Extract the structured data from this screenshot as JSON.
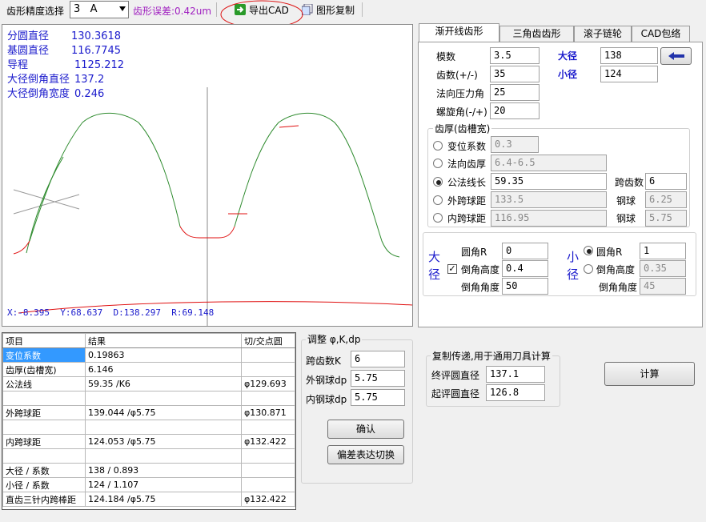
{
  "toolbar": {
    "precision_label": "齿形精度选择",
    "precision_value": "3   A",
    "error_text": "齿形误差:0.42um",
    "export_cad": "导出CAD",
    "copy_graph": "图形复制"
  },
  "overlay": {
    "lines": [
      {
        "label": "分圆直径",
        "value": "130.3618"
      },
      {
        "label": "基圆直径",
        "value": "116.7745"
      },
      {
        "label": "导程",
        "value": "1125.212"
      },
      {
        "label": "大径倒角直径",
        "value": "137.2"
      },
      {
        "label": "大径倒角宽度",
        "value": "0.246"
      }
    ],
    "coords": "X:-8.395  Y:68.637  D:138.297  R:69.148"
  },
  "tabs": [
    {
      "label": "渐开线齿形",
      "active": true
    },
    {
      "label": "三角齿齿形",
      "active": false
    },
    {
      "label": "滚子链轮",
      "active": false
    },
    {
      "label": "CAD包络",
      "active": false
    }
  ],
  "params": {
    "module_label": "模数",
    "module_value": "3.5",
    "teeth_label": "齿数(+/-)",
    "teeth_value": "35",
    "pressure_label": "法向压力角",
    "pressure_value": "25",
    "helix_label": "螺旋角(-/+)",
    "helix_value": "20",
    "major_label": "大径",
    "major_value": "138",
    "minor_label": "小径",
    "minor_value": "124"
  },
  "thickness": {
    "group_label": "齿厚(齿槽宽)",
    "options": [
      {
        "label": "变位系数",
        "value": "0.3",
        "selected": false
      },
      {
        "label": "法向齿厚",
        "value": "6.4-6.5",
        "selected": false
      },
      {
        "label": "公法线长",
        "value": "59.35",
        "selected": true
      },
      {
        "label": "外跨球距",
        "value": "133.5",
        "selected": false
      },
      {
        "label": "内跨球距",
        "value": "116.95",
        "selected": false
      }
    ],
    "span_label": "跨齿数",
    "span_value": "6",
    "ball1_label": "钢球",
    "ball1_value": "6.25",
    "ball2_label": "钢球",
    "ball2_value": "5.75"
  },
  "major_end": {
    "side_label": "大径",
    "fillet_label": "圆角R",
    "fillet_value": "0",
    "chamfer_h_label": "倒角高度",
    "chamfer_h_value": "0.4",
    "chamfer_a_label": "倒角角度",
    "chamfer_a_value": "50"
  },
  "minor_end": {
    "side_label": "小径",
    "fillet_label": "圆角R",
    "fillet_value": "1",
    "chamfer_h_label": "倒角高度",
    "chamfer_h_value": "0.35",
    "chamfer_a_label": "倒角角度",
    "chamfer_a_value": "45"
  },
  "results": {
    "headers": [
      "项目",
      "结果",
      "切/交点圆"
    ],
    "rows": [
      [
        "变位系数",
        "0.19863",
        ""
      ],
      [
        "齿厚(齿槽宽)",
        "6.146",
        ""
      ],
      [
        "公法线",
        "59.35 /K6",
        "φ129.693"
      ],
      [
        "",
        "",
        ""
      ],
      [
        "外跨球距",
        "139.044 /φ5.75",
        "φ130.871"
      ],
      [
        "",
        "",
        ""
      ],
      [
        "内跨球距",
        "124.053 /φ5.75",
        "φ132.422"
      ],
      [
        "",
        "",
        ""
      ],
      [
        "大径 / 系数",
        "138 / 0.893",
        ""
      ],
      [
        "小径 / 系数",
        "124 / 1.107",
        ""
      ],
      [
        "直齿三针内跨棒距",
        "124.184 /φ5.75",
        "φ132.422"
      ]
    ]
  },
  "adjust": {
    "title": "调整 φ,K,dp",
    "span_label": "跨齿数K",
    "span_value": "6",
    "outer_label": "外钢球dp",
    "outer_value": "5.75",
    "inner_label": "内钢球dp",
    "inner_value": "5.75",
    "confirm": "确认",
    "toggle": "偏差表达切换"
  },
  "copy_pass": {
    "title": "复制传递,用于通用刀具计算",
    "end_label": "终评圆直径",
    "end_value": "137.1",
    "start_label": "起评圆直径",
    "start_value": "126.8"
  },
  "calc_button": "计算",
  "colors": {
    "curve": "#2e8b2e",
    "red": "#e01010",
    "blue_text": "#1a1acc",
    "selection": "#3399ff"
  }
}
